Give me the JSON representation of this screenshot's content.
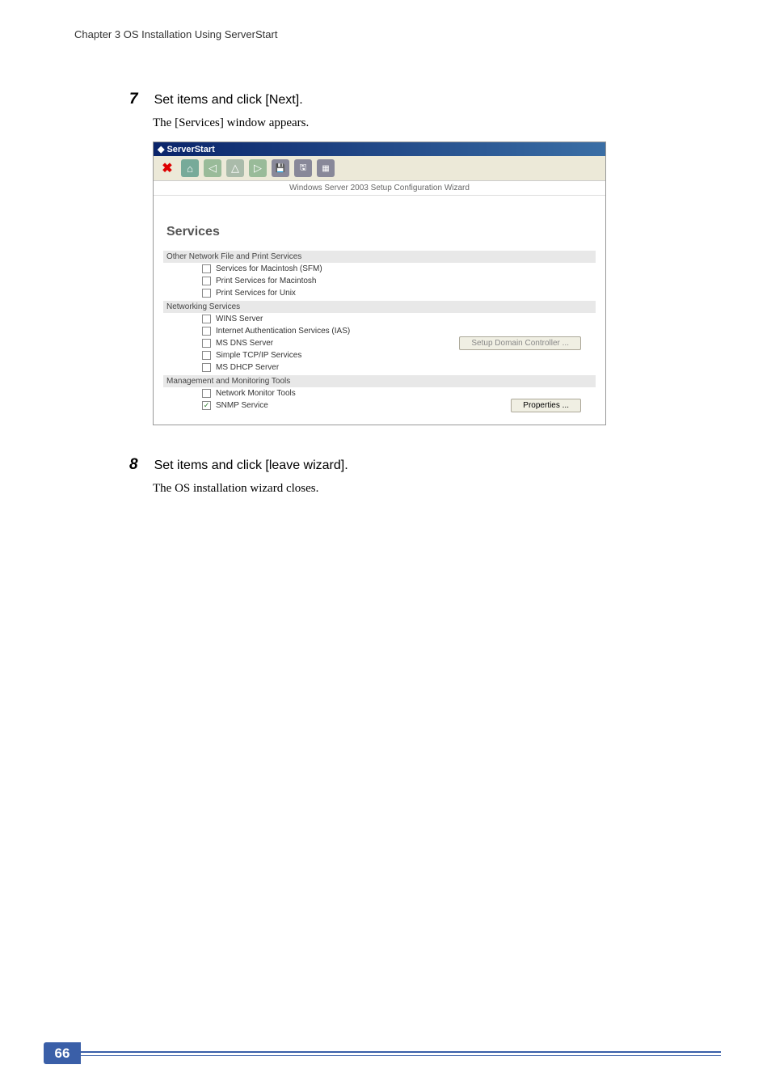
{
  "header": "Chapter 3  OS Installation Using ServerStart",
  "page_number": "66",
  "steps": [
    {
      "number": "7",
      "title": "Set items and click [Next].",
      "description": "The [Services] window appears."
    },
    {
      "number": "8",
      "title": "Set items and click [leave wizard].",
      "description": "The OS installation wizard closes."
    }
  ],
  "window": {
    "title": "ServerStart",
    "banner": "Windows Server 2003 Setup Configuration Wizard",
    "panel_title": "Services",
    "sections": [
      {
        "header": "Other Network File and Print Services",
        "items": [
          {
            "label": "Services for Macintosh (SFM)",
            "checked": false
          },
          {
            "label": "Print Services for Macintosh",
            "checked": false
          },
          {
            "label": "Print Services for Unix",
            "checked": false
          }
        ]
      },
      {
        "header": "Networking Services",
        "items": [
          {
            "label": "WINS Server",
            "checked": false
          },
          {
            "label": "Internet Authentication Services (IAS)",
            "checked": false
          },
          {
            "label": "MS DNS Server",
            "checked": false,
            "button": "Setup Domain Controller ...",
            "button_enabled": false
          },
          {
            "label": "Simple TCP/IP Services",
            "checked": false
          },
          {
            "label": "MS DHCP Server",
            "checked": false
          }
        ]
      },
      {
        "header": "Management and Monitoring Tools",
        "items": [
          {
            "label": "Network Monitor Tools",
            "checked": false
          },
          {
            "label": "SNMP Service",
            "checked": true,
            "button": "Properties ...",
            "button_enabled": true
          }
        ]
      }
    ]
  }
}
